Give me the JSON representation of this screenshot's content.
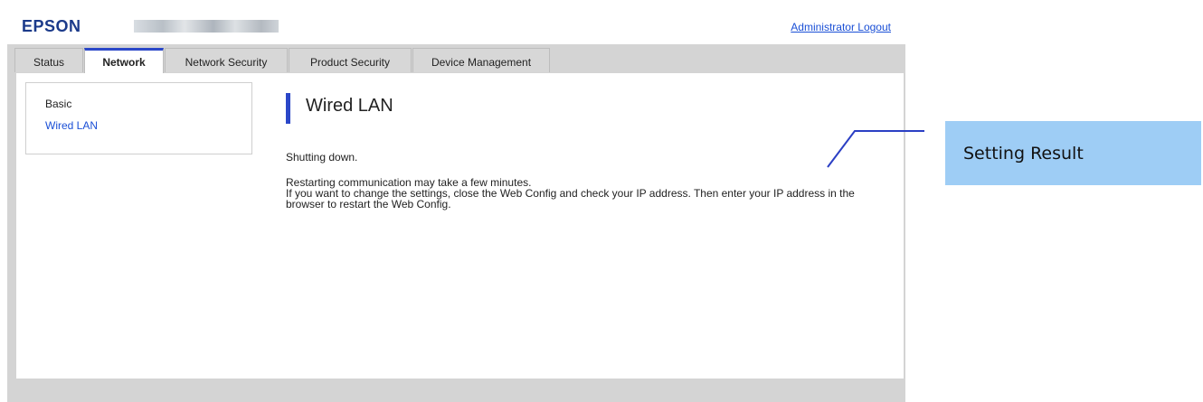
{
  "header": {
    "logo": "EPSON",
    "admin_logout": "Administrator Logout"
  },
  "tabs": [
    {
      "label": "Status",
      "active": false
    },
    {
      "label": "Network",
      "active": true
    },
    {
      "label": "Network Security",
      "active": false
    },
    {
      "label": "Product Security",
      "active": false
    },
    {
      "label": "Device Management",
      "active": false
    }
  ],
  "sidebar": {
    "items": [
      {
        "label": "Basic"
      },
      {
        "label": "Wired LAN"
      }
    ]
  },
  "main": {
    "title": "Wired LAN",
    "message1": "Shutting down.",
    "message2_lines": [
      "Restarting communication may take a few minutes.",
      "If you want to change the settings, close the Web Config and check your IP address. Then enter your IP address in the",
      "browser to restart the Web Config."
    ]
  },
  "callout": {
    "label": "Setting Result"
  },
  "colors": {
    "accent": "#2b47c8",
    "link": "#1a4fd6",
    "callout_bg": "#9ecdf5",
    "frame_bg": "#d4d4d4"
  }
}
